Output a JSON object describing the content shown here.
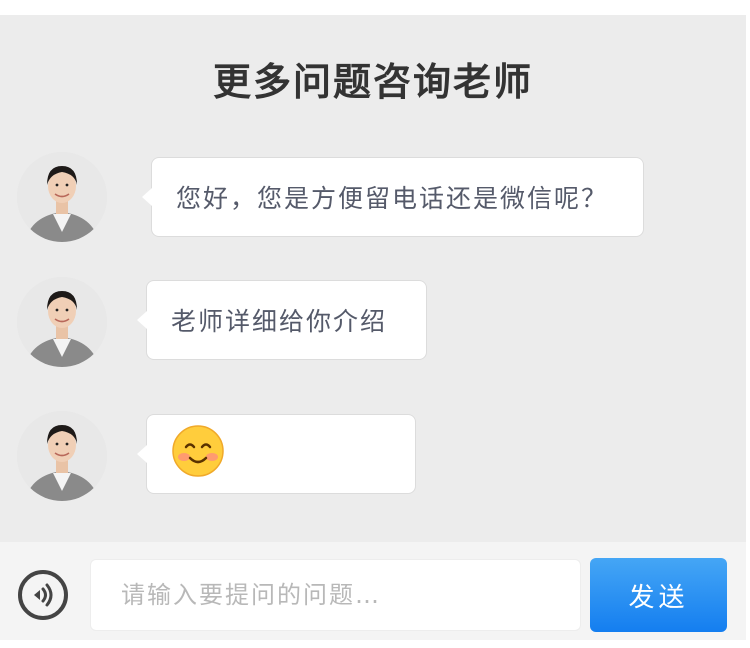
{
  "header": {
    "title": "更多问题咨询老师"
  },
  "messages": [
    {
      "sender": "teacher",
      "text": "您好，您是方便留电话还是微信呢？"
    },
    {
      "sender": "teacher",
      "text": "老师详细给你介绍"
    },
    {
      "sender": "teacher",
      "text": "",
      "emoji": "smiling-face-emoji"
    }
  ],
  "input": {
    "placeholder": "请输入要提问的问题…",
    "value": ""
  },
  "send_button": {
    "label": "发送"
  },
  "icons": {
    "voice": "voice-icon",
    "avatar": "teacher-avatar"
  },
  "colors": {
    "accent": "#1a82f0",
    "panel_bg": "#ececec",
    "bubble_bg": "#ffffff",
    "text": "#555a6a"
  }
}
